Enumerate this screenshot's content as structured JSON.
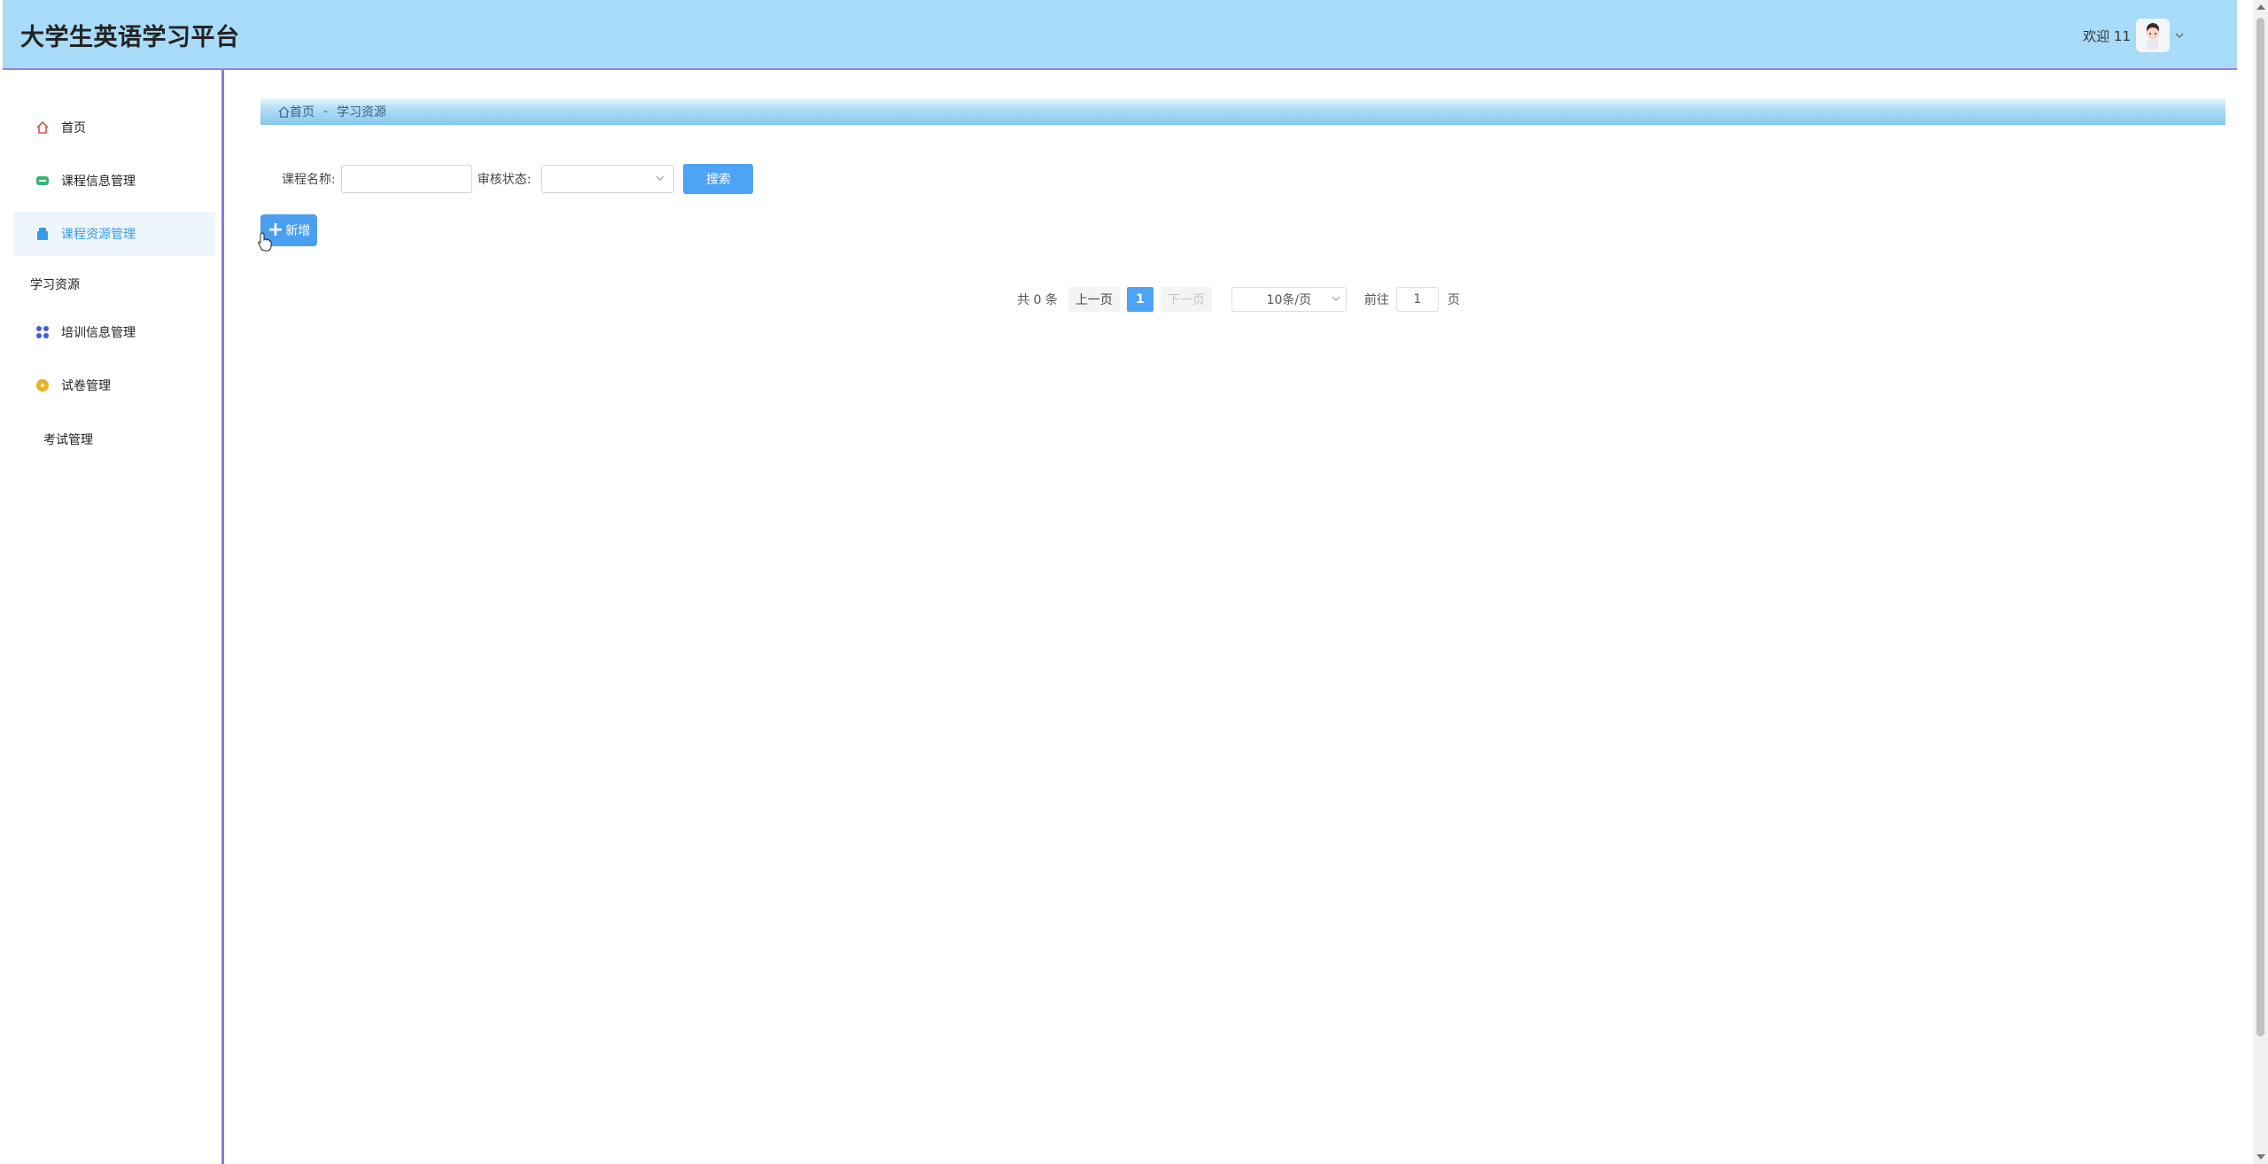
{
  "header": {
    "title": "大学生英语学习平台",
    "welcome": "欢迎 11"
  },
  "sidebar": {
    "items": [
      {
        "label": "首页",
        "icon": "home-icon"
      },
      {
        "label": "课程信息管理",
        "icon": "course-icon"
      },
      {
        "label": "课程资源管理",
        "icon": "resource-icon",
        "active": true
      },
      {
        "label": "学习资源",
        "icon": ""
      },
      {
        "label": "培训信息管理",
        "icon": "grid-icon"
      },
      {
        "label": "试卷管理",
        "icon": "paper-icon"
      },
      {
        "label": "考试管理",
        "icon": ""
      }
    ]
  },
  "breadcrumb": {
    "home": "首页",
    "separator": "-",
    "current": "学习资源"
  },
  "search": {
    "course_name_label": "课程名称:",
    "course_name_value": "",
    "status_label": "审核状态:",
    "status_value": "",
    "search_button": "搜索"
  },
  "actions": {
    "add_button": "新增"
  },
  "pagination": {
    "total": "共 0 条",
    "prev": "上一页",
    "current_page": "1",
    "next": "下一页",
    "page_size": "10条/页",
    "goto_label": "前往",
    "goto_value": "1",
    "page_suffix": "页"
  },
  "colors": {
    "header_bg": "#a7dbf7",
    "accent": "#4da3f4",
    "active_text": "#3a9ae8",
    "border_purple": "#8c7ad9"
  }
}
